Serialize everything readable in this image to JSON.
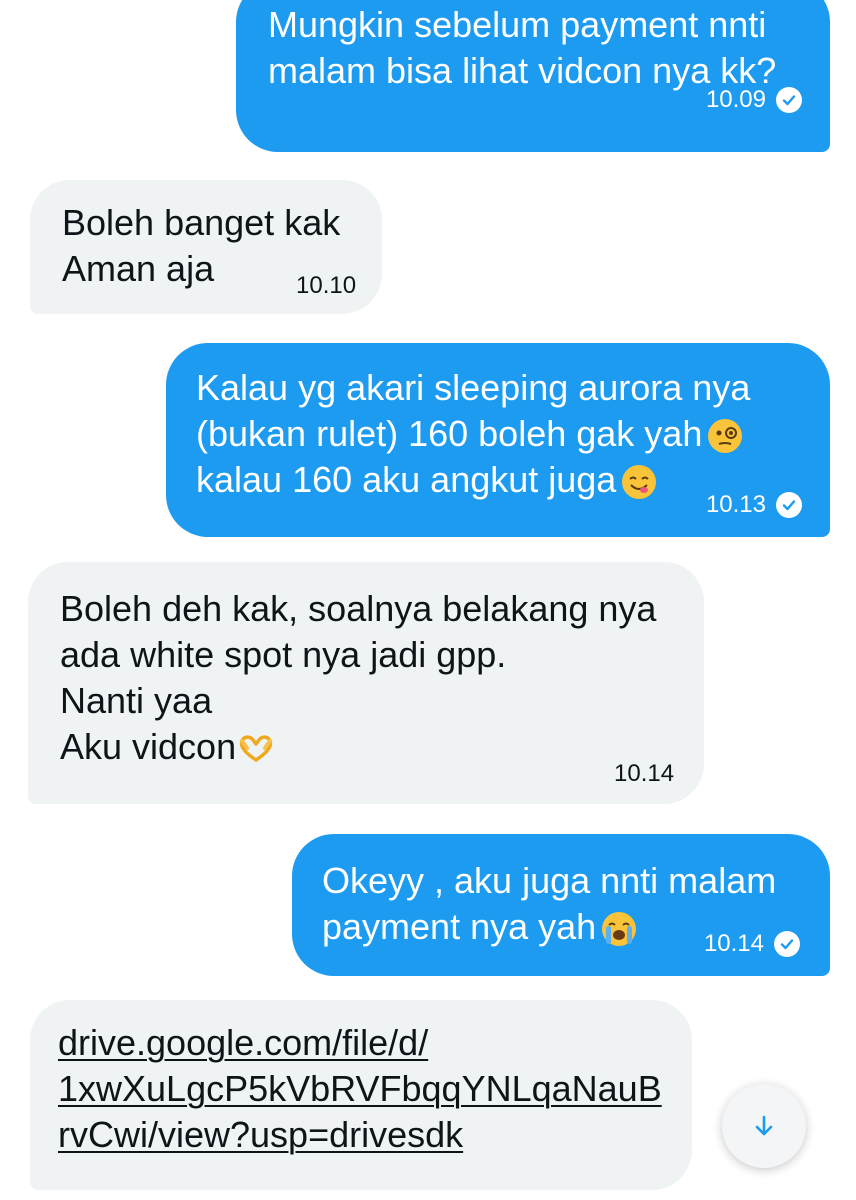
{
  "colors": {
    "sent_bubble": "#1d9bf0",
    "received_bubble": "#eff3f4",
    "sent_text": "#ffffff",
    "received_text": "#0f1419"
  },
  "messages": [
    {
      "direction": "sent",
      "lines": [
        "Mungkin sebelum payment nnti",
        "malam bisa lihat vidcon nya kk?"
      ],
      "time": "10.09",
      "status_icon": "read-check-icon"
    },
    {
      "direction": "received",
      "lines": [
        "Boleh banget kak",
        "Aman aja"
      ],
      "time": "10.10"
    },
    {
      "direction": "sent",
      "lines": [
        "Kalau yg akari sleeping aurora nya",
        "(bukan rulet) 160 boleh gak yah",
        "kalau 160 aku angkut juga"
      ],
      "emojis": [
        "face-with-monocle-emoji",
        "face-savoring-food-emoji"
      ],
      "time": "10.13",
      "status_icon": "read-check-icon"
    },
    {
      "direction": "received",
      "lines": [
        "Boleh deh kak, soalnya belakang nya",
        "ada white spot nya jadi gpp.",
        "Nanti yaa",
        "Aku vidcon"
      ],
      "emojis": [
        "heart-hands-emoji"
      ],
      "time": "10.14"
    },
    {
      "direction": "sent",
      "lines": [
        "Okeyy , aku juga nnti malam",
        "payment nya yah"
      ],
      "emojis": [
        "loudly-crying-face-emoji"
      ],
      "time": "10.14",
      "status_icon": "read-check-icon"
    },
    {
      "direction": "received",
      "link_lines": [
        "drive.google.com/file/d/",
        "1xwXuLgcP5kVbRVFbqqYNLqaNauB",
        "rvCwi/view?usp=drivesdk"
      ]
    }
  ],
  "scroll_button": {
    "icon": "arrow-down-icon"
  }
}
